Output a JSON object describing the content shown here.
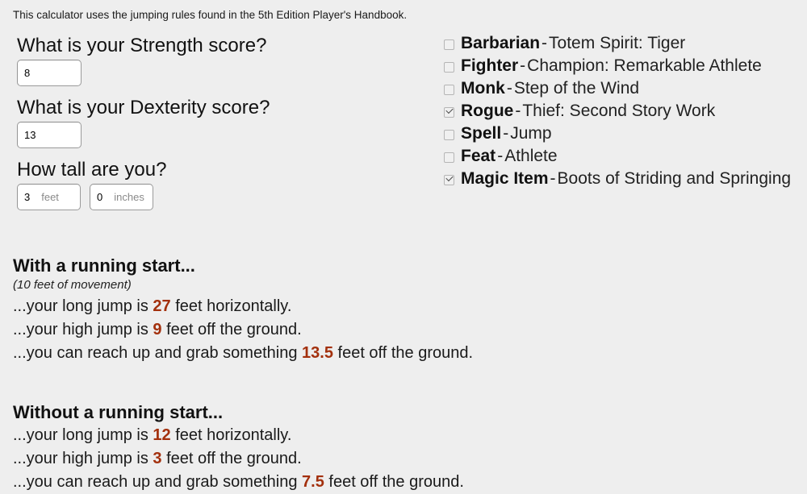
{
  "intro": "This calculator uses the jumping rules found in the 5th Edition Player's Handbook.",
  "form": {
    "strength": {
      "label": "What is your Strength score?",
      "value": "8",
      "placeholder": "Strength"
    },
    "dexterity": {
      "label": "What is your Dexterity score?",
      "value": "13",
      "placeholder": "Dexterity"
    },
    "height": {
      "label": "How tall are you?",
      "feet": {
        "value": "3",
        "unit": "feet",
        "placeholder": "feet"
      },
      "inches": {
        "value": "0",
        "unit": "inches",
        "placeholder": "inches"
      }
    }
  },
  "options": [
    {
      "name": "Barbarian",
      "sep": "-",
      "desc": "Totem Spirit: Tiger",
      "checked": false
    },
    {
      "name": "Fighter",
      "sep": "-",
      "desc": "Champion: Remarkable Athlete",
      "checked": false
    },
    {
      "name": "Monk",
      "sep": "-",
      "desc": "Step of the Wind",
      "checked": false
    },
    {
      "name": "Rogue",
      "sep": "-",
      "desc": "Thief: Second Story Work",
      "checked": true
    },
    {
      "name": "Spell",
      "sep": "-",
      "desc": "Jump",
      "checked": false
    },
    {
      "name": "Feat",
      "sep": "-",
      "desc": "Athlete",
      "checked": false
    },
    {
      "name": "Magic Item",
      "sep": "-",
      "desc": "Boots of Striding and Springing",
      "checked": true
    }
  ],
  "results": {
    "running": {
      "heading": "With a running start...",
      "subheading": "(10 feet of movement)",
      "long_pre": "...your long jump is ",
      "long_value": "27",
      "long_post": " feet horizontally.",
      "high_pre": "...your high jump is ",
      "high_value": "9",
      "high_post": " feet off the ground.",
      "reach_pre": "...you can reach up and grab something ",
      "reach_value": "13.5",
      "reach_post": " feet off the ground."
    },
    "standing": {
      "heading": "Without a running start...",
      "long_pre": "...your long jump is ",
      "long_value": "12",
      "long_post": " feet horizontally.",
      "high_pre": "...your high jump is ",
      "high_value": "3",
      "high_post": " feet off the ground.",
      "reach_pre": "...you can reach up and grab something ",
      "reach_value": "7.5",
      "reach_post": " feet off the ground."
    }
  },
  "colors": {
    "background": "#eeeeee",
    "text": "#1a1a1a",
    "number_accent": "#a3300d",
    "input_border": "#9a9a9a",
    "unit_text": "#8a8a8a"
  }
}
